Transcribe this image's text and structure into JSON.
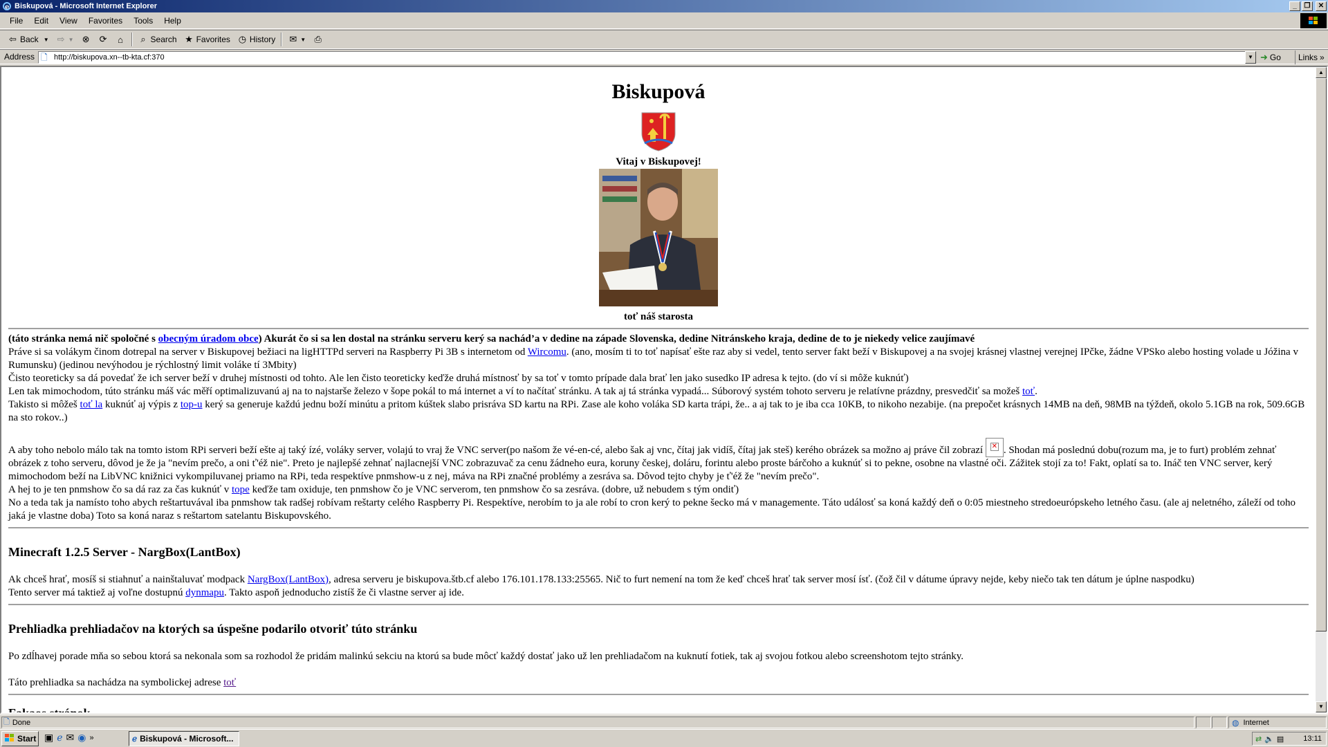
{
  "window": {
    "title": "Biskupová - Microsoft Internet Explorer",
    "controls": [
      "_",
      "❐",
      "✕"
    ]
  },
  "menu": [
    "File",
    "Edit",
    "View",
    "Favorites",
    "Tools",
    "Help"
  ],
  "toolbar": {
    "back": "Back",
    "search": "Search",
    "favorites": "Favorites",
    "history": "History"
  },
  "address": {
    "label": "Address",
    "url": "http://biskupova.xn--tb-kta.cf:370",
    "go": "Go",
    "links": "Links"
  },
  "page": {
    "title": "Biskupová",
    "welcome": "Vitaj v Biskupovej!",
    "caption": "toť náš starosta",
    "intro_bold_1": "(táto stránka nemá nič spoločné s ",
    "intro_link": "obecným úradom obce",
    "intro_bold_2": ") Akurát čo si sa len dostal na stránku serveru kerý sa nachád’a v dedine na západe Slovenska, dedine Nitránskeho kraja, dedine de to je niekedy velice zaujímavé",
    "p1a": "Práve si sa volákym činom dotrepal na server v Biskupovej bežiaci na ligHTTPd serveri na Raspberry Pi 3B s internetom od ",
    "p1_link": "Wircomu",
    "p1b": ". (ano, mosím ti to toť napísať ešte raz aby si vedel, tento server fakt beží v Biskupovej a na svojej krásnej vlastnej verejnej IPčke, žádne VPSko alebo hosting volade u Jóžina v Rumunsku) (jedinou nevýhodou je rýchlostný limit voláke tí 3Mbity)",
    "p2": "Čisto teoreticky sa dá povedať že ich server beží v druhej místnosti od tohto. Ale len čisto teoreticky keďže druhá místnosť by sa toť v tomto prípade dala brať len jako susedko IP adresa k tejto. (do ví si môže kuknúť)",
    "p3a": "Len tak mimochodom, túto stránku máš vác měří optimalizuvanú aj na to najstarše železo v šope pokál to má internet a ví to načítať stránku. A tak aj tá stránka vypadá... Súborový systém tohoto serveru je relatívne prázdny, presvedčiť sa možeš ",
    "p3_link": "toť",
    "p3b": ".",
    "p4a": "Takisto si môžeš ",
    "p4_link1": "toť la",
    "p4b": " kuknúť aj výpis z ",
    "p4_link2": "top-u",
    "p4c": " kerý sa generuje každú jednu boží minútu a pritom kúštek slabo prisráva SD kartu na RPi. Zase ale koho voláka SD karta trápi, že.. a aj tak to je iba cca 10KB, to nikoho nezabije. (na prepočet krásnych 14MB na deň, 98MB na týždeň, okolo 5.1GB na rok, 509.6GB na sto rokov..)",
    "p5a": "A aby toho nebolo málo tak na tomto istom RPi serveri beží ešte aj taký ízé, voláky server, volajú to vraj že VNC server(po našom že vé-en-cé, alebo šak aj vnc, čítaj jak vidíš, čítaj jak steš) kerého obrázek sa možno aj práve čil zobrazí ",
    "p5b": ". Shodan má poslednú dobu(rozum ma, je to furt) problém zehnať obrázek z toho serveru, dôvod je že ja \"nevím prečo, a oni ť'éž nie\". Preto je najlepšé zehnať najlacnejší VNC zobrazuvač za cenu žádneho eura, koruny českej, doláru, forintu alebo proste bárčoho a kuknúť si to pekne, osobne na vlastné oči. Zážitek stojí za to! Fakt, oplatí sa to. Ináč ten VNC server, kerý mimochodom beží na LibVNC knižnici vykompiluvanej priamo na RPi, teda respektíve pnmshow-u z nej, máva na RPi značné problémy a zesráva sa. Dôvod tejto chyby je ť'éž že \"nevím prečo\".",
    "p6a": "A hej to je ten pnmshow čo sa dá raz za čas kuknúť v ",
    "p6_link": "tope",
    "p6b": " keďže tam oxiduje, ten pnmshow čo je VNC serverom, ten pnmshow čo sa zesráva. (dobre, už nebudem s tým ondiť)",
    "p7": "No a teda tak ja namísto toho abych reštartuvával iba pnmshow tak radšej robívam reštarty celého Raspberry Pi. Respektíve, nerobím to ja ale robí to cron kerý to pekne šecko má v managemente. Táto událosť sa koná každý deň o 0:05 miestneho stredoeurópskeho letného času. (ale aj neletného, záleží od toho jaká je vlastne doba) Toto sa koná naraz s reštartom satelantu Biskupovského.",
    "h_minecraft": "Minecraft 1.2.5 Server - NargBox(LantBox)",
    "mc1a": "Ak chceš hrať, mosíš si stiahnuť a nainštaluvať modpack ",
    "mc1_link": "NargBox(LantBox)",
    "mc1b": ", adresa serveru je biskupova.štb.cf alebo 176.101.178.133:25565. Nič to furt nemení na tom že keď chceš hrať tak server mosí ísť. (čož čil v dátume úpravy nejde, keby niečo tak ten dátum je úplne naspodku)",
    "mc2a": "Tento server má taktiež aj voľne dostupnú ",
    "mc2_link": "dynmapu",
    "mc2b": ". Takto aspoň jednoducho zistíš že či vlastne server aj ide.",
    "h_browsers": "Prehliadka prehliadačov na ktorých sa úspešne podarilo otvoriť túto stránku",
    "br1": "Po zdĺhavej porade mňa so sebou ktorá sa nekonala som sa rozhodol že pridám malinkú sekciu na ktorú sa bude môcť každý dostať jako už len prehliadačom na kuknutí fotiek, tak aj svojou fotkou alebo screenshotom tejto stránky.",
    "br2a": "Táto prehliadka sa nachádza na symbolickej adrese ",
    "br2_link": "toť",
    "h_cut": "Fakaos stránok"
  },
  "status": {
    "text": "Done",
    "zone": "Internet"
  },
  "taskbar": {
    "start": "Start",
    "task": "Biskupová - Microsoft...",
    "clock": "13:11"
  }
}
